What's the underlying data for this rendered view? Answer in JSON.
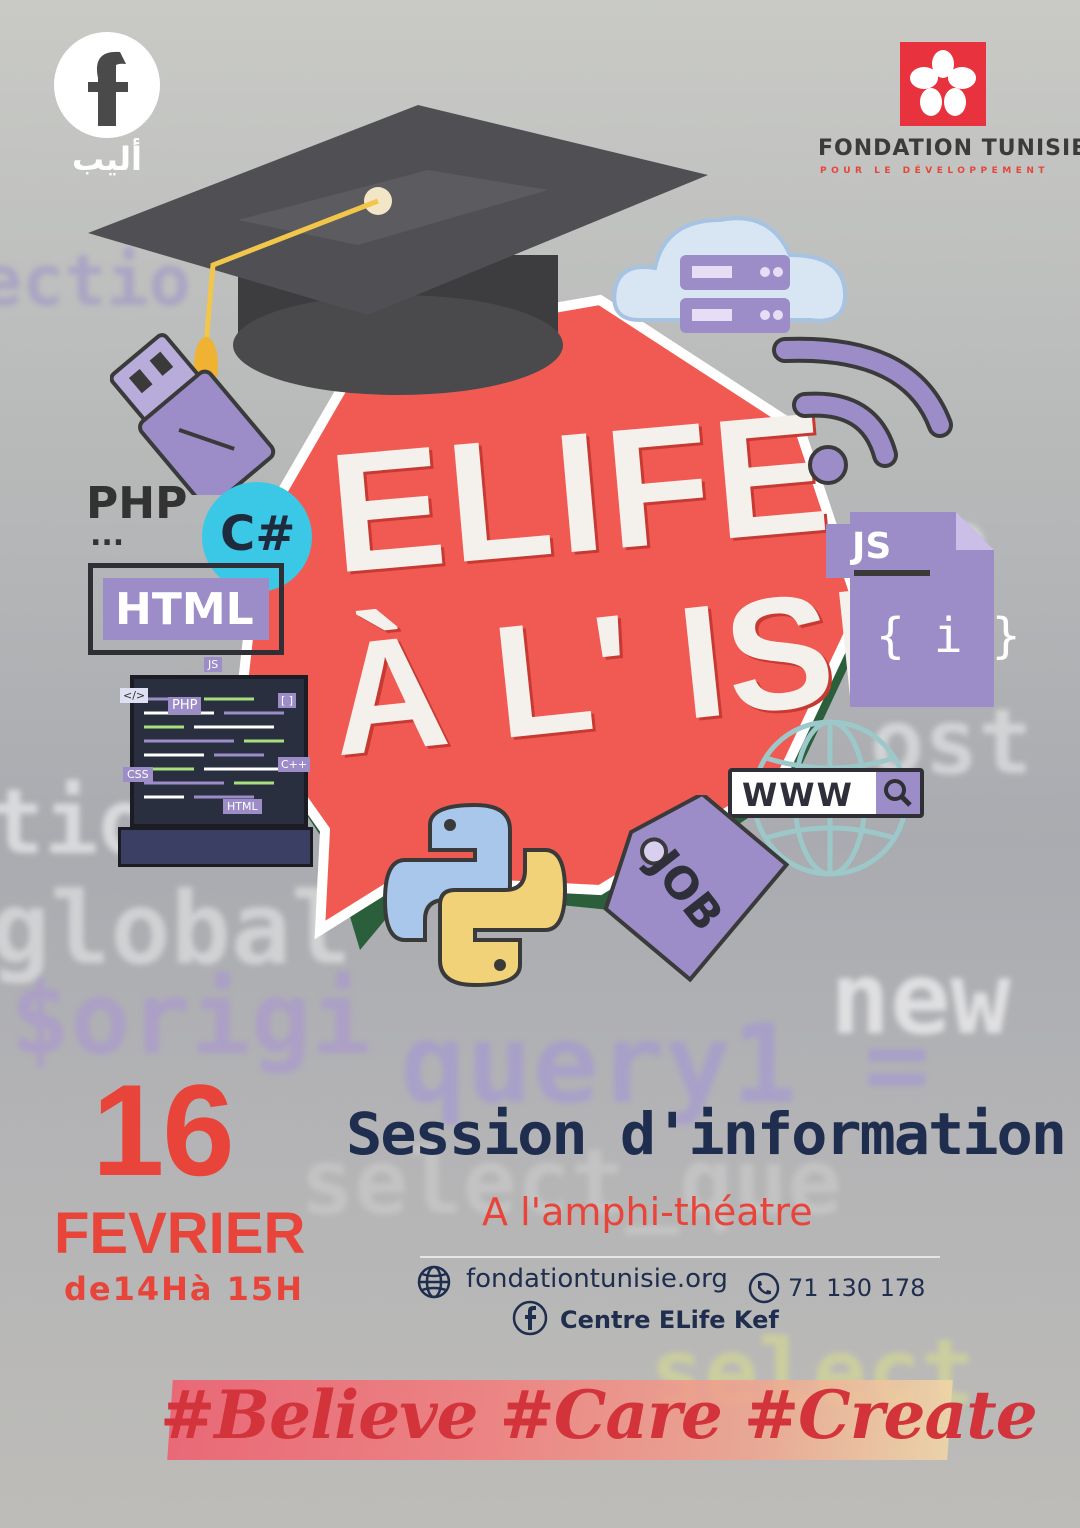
{
  "brand": {
    "elife_logo_text": "أليب"
  },
  "partner": {
    "name": "FONDATION TUNISIE",
    "tagline": "POUR LE DÉVELOPPEMENT"
  },
  "title": {
    "line1": "ELIFE",
    "line2": "À L' ISI"
  },
  "tech_labels": {
    "php": "PHP",
    "dots": "...",
    "csharp": "C#",
    "html": "HTML",
    "js": "JS",
    "js_braces": "{ i }",
    "www": "WWW",
    "job": "JOB",
    "laptop_js": "JS",
    "laptop_php": "PHP",
    "laptop_css": "CSS",
    "laptop_cpp": "C++",
    "laptop_html": "HTML",
    "laptop_code": "</>",
    "laptop_bracket": "[ ]"
  },
  "event": {
    "day": "16",
    "month": "FEVRIER",
    "time": "de14Hà 15H",
    "heading": "Session d'information",
    "venue": "A l'amphi-théatre"
  },
  "contact": {
    "website": "fondationtunisie.org",
    "phone": "71 130 178",
    "facebook": "Centre ELife Kef"
  },
  "hashtags": "#Believe #Care #Create",
  "colors": {
    "accent_red": "#e8443a",
    "navy": "#1f2d4e",
    "purple": "#9c8dc9",
    "burst": "#f15a52"
  }
}
